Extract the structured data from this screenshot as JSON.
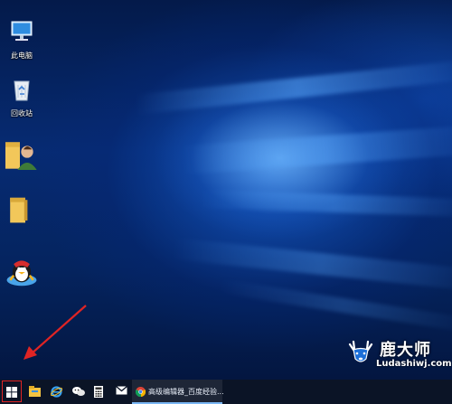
{
  "desktop": {
    "icons": [
      {
        "label": "此电脑",
        "icon": "this-pc-icon"
      },
      {
        "label": "回收站",
        "icon": "recycle-bin-icon"
      },
      {
        "label": "",
        "icon": "user-folder-icon"
      },
      {
        "label": "",
        "icon": "folder-icon"
      },
      {
        "label": "",
        "icon": "qq-penguin-icon"
      }
    ]
  },
  "taskbar": {
    "start": {
      "icon": "windows-start-icon",
      "highlight_color": "#e02424"
    },
    "pinned": [
      {
        "icon": "file-explorer-icon"
      },
      {
        "icon": "internet-explorer-icon"
      },
      {
        "icon": "wechat-icon"
      },
      {
        "icon": "calculator-icon"
      },
      {
        "icon": "mail-icon"
      }
    ],
    "active_window": {
      "icon": "chrome-icon",
      "label": "高级编辑器_百度经验..."
    }
  },
  "annotation": {
    "arrow_color": "#e02424"
  },
  "watermark": {
    "title": "鹿大师",
    "url": "Ludashiwj.com",
    "icon": "deer-logo-icon"
  }
}
